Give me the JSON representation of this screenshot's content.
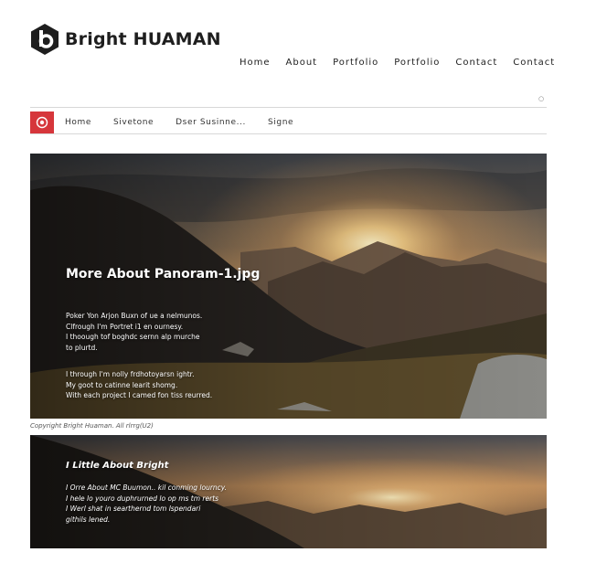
{
  "brand": {
    "name": "Bright HUAMAN",
    "logo_letter": "b",
    "logo_color": "#1e1e1e",
    "accent_color": "#d6363b"
  },
  "top_nav": [
    "Home",
    "About",
    "Portfolio",
    "Portfolio",
    "Contact",
    "Contact"
  ],
  "search_dot": "○",
  "sub_nav": {
    "icon": "eye-icon",
    "items": [
      "Home",
      "Sivetone",
      "Dser Susinne...",
      "Signe"
    ]
  },
  "hero1": {
    "title": "More About Panoram-1.jpg",
    "para1": "Poker Yon Arjon Buxn of ue a nelmunos.\nClfrough I'm Portret i1 en ournesy.\nI thoough tof boghdc sernn alp murche\nto plurtd.",
    "para2": "I through I'm nolly frdhotoyarsn ightr.\nMy goot to catinne learit shomg.\nWith each project I camed fon tiss reurred."
  },
  "caption": "Copyright Bright Huaman. All rlrrg(U2)",
  "hero2": {
    "title": "I Little About Bright",
    "para": "I Orre About MC Buumon.. kil conming lourncy.\nI hele lo youro duphrurned lo op ms tm rerts\nI Werl shat in searthernd tom lspendari\ngithils lened."
  }
}
